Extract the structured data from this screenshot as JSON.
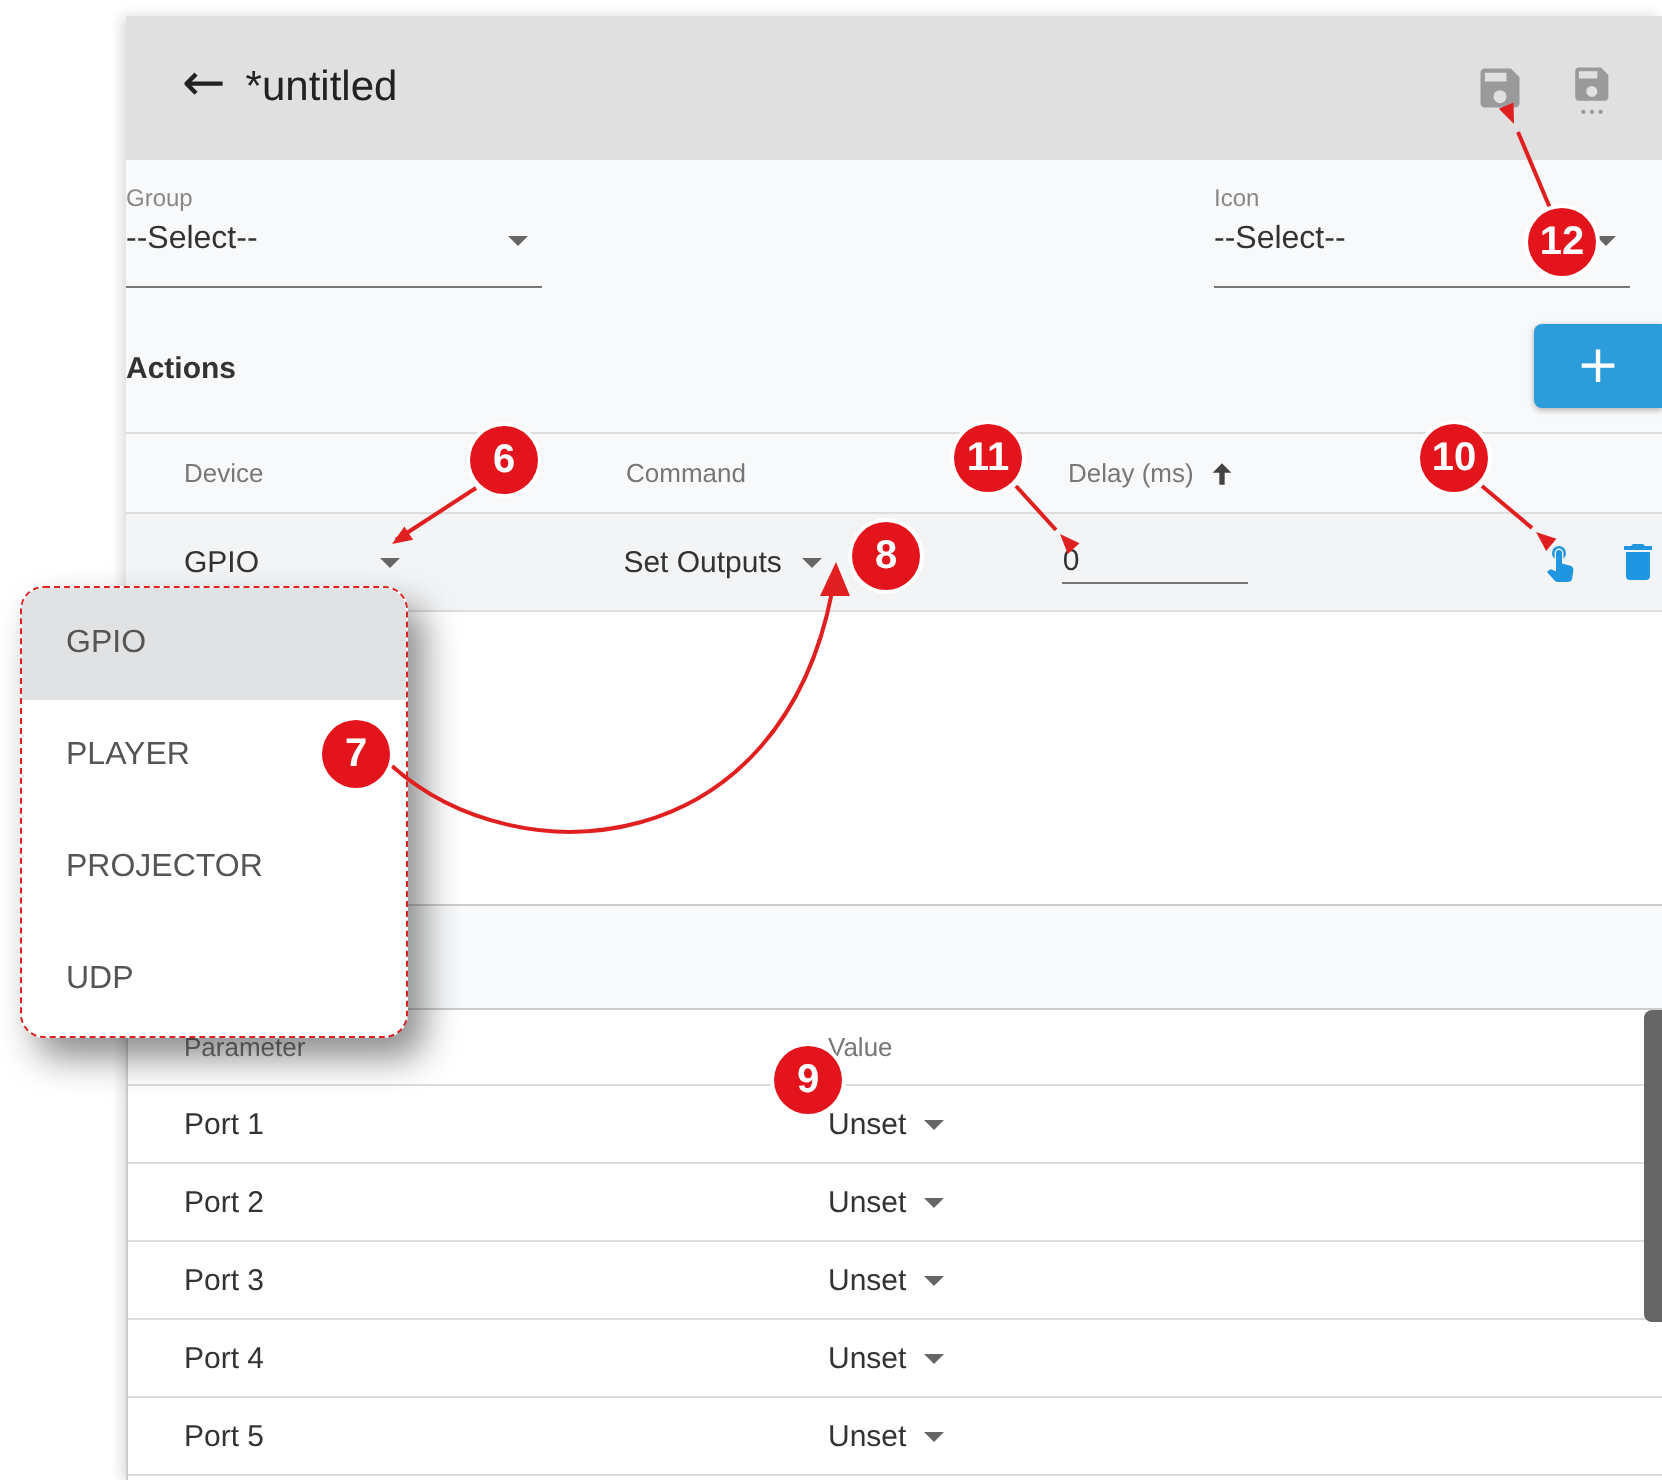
{
  "header": {
    "back": "←",
    "title": "*untitled"
  },
  "fields": [
    {
      "label": "Group",
      "value": "--Select--"
    },
    {
      "label": "Icon",
      "value": "--Select--"
    }
  ],
  "actions": {
    "title": "Actions",
    "add": "+",
    "columns": [
      "Device",
      "Command",
      "Delay (ms)"
    ],
    "rows": [
      {
        "device": "GPIO",
        "command": "Set Outputs",
        "delay": "0"
      }
    ]
  },
  "parameters": {
    "columns": [
      "Parameter",
      "Value"
    ],
    "rows": [
      {
        "name": "Port 1",
        "value": "Unset"
      },
      {
        "name": "Port 2",
        "value": "Unset"
      },
      {
        "name": "Port 3",
        "value": "Unset"
      },
      {
        "name": "Port 4",
        "value": "Unset"
      },
      {
        "name": "Port 5",
        "value": "Unset"
      }
    ]
  },
  "device_menu": [
    {
      "label": "GPIO",
      "selected": true
    },
    {
      "label": "PLAYER",
      "selected": false
    },
    {
      "label": "PROJECTOR",
      "selected": false
    },
    {
      "label": "UDP",
      "selected": false
    }
  ],
  "callouts": [
    "12",
    "6",
    "11",
    "10",
    "8",
    "7",
    "9"
  ]
}
